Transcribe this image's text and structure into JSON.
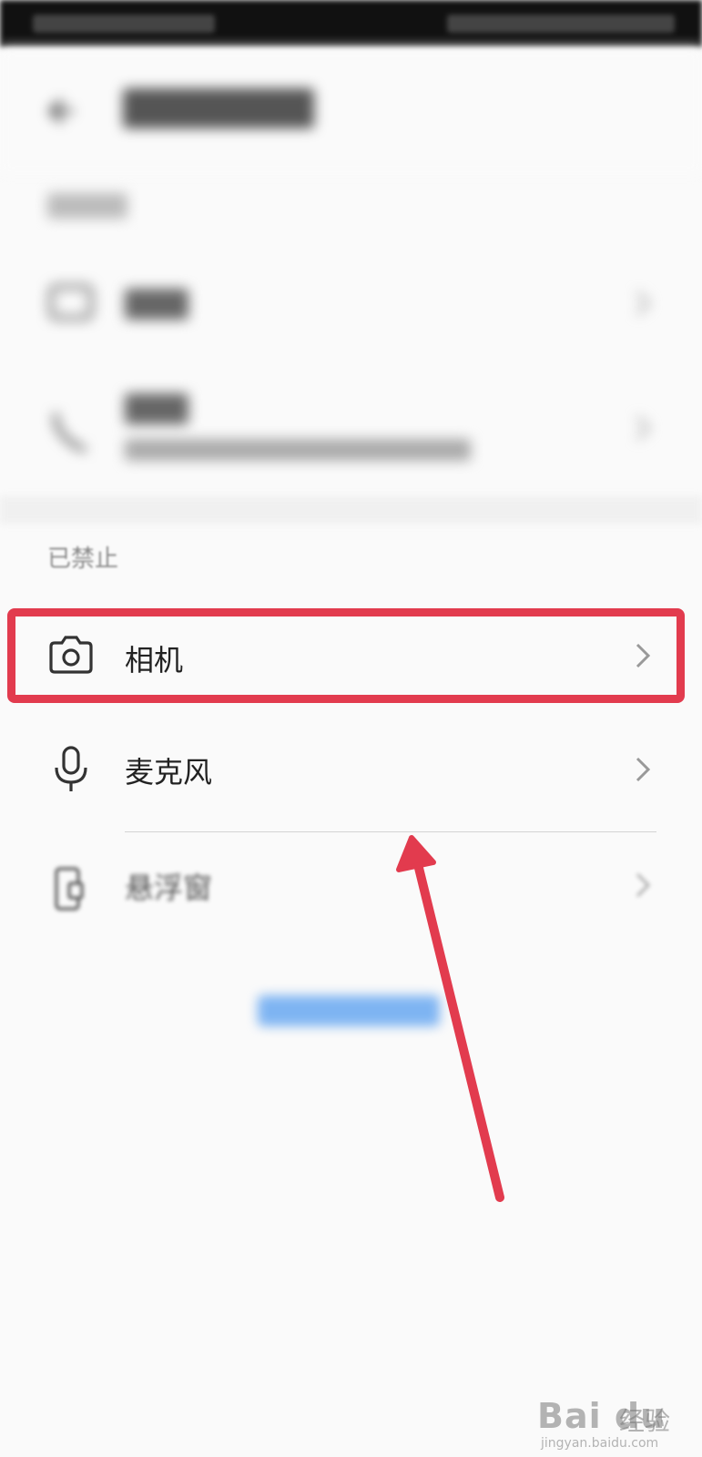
{
  "status_bar": {},
  "header": {
    "title": ""
  },
  "allowed_section": {
    "label": "",
    "items": [
      {
        "icon": "folder-icon",
        "label": "",
        "sub": ""
      },
      {
        "icon": "phone-icon",
        "label": "",
        "sub": ""
      }
    ]
  },
  "denied_section": {
    "label": "已禁止",
    "items": [
      {
        "icon": "camera-icon",
        "label": "相机"
      },
      {
        "icon": "microphone-icon",
        "label": "麦克风"
      },
      {
        "icon": "floating-window-icon",
        "label": "悬浮窗"
      }
    ]
  },
  "footer_link": {
    "label": ""
  },
  "annotation": {
    "highlight_color": "#e23b4e",
    "arrow_color": "#e23b4e"
  },
  "watermark": {
    "brand": "Bai du",
    "cn": "经验",
    "url": "jingyan.baidu.com"
  }
}
